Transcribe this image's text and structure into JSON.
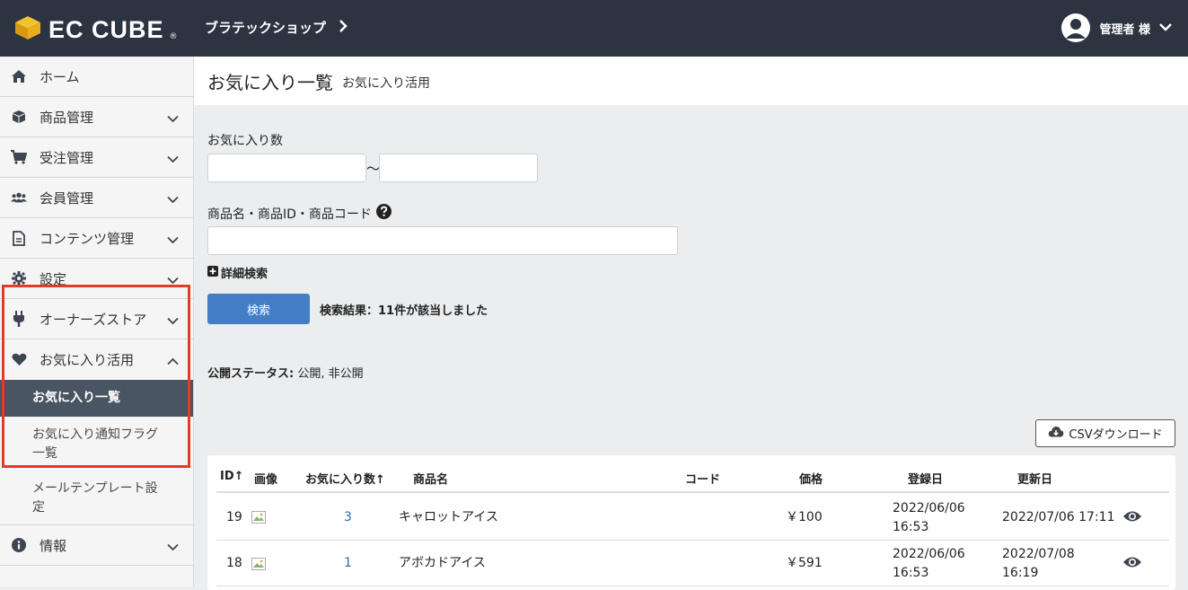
{
  "brand": {
    "logo_text": "EC CUBE",
    "logo_reg": "®"
  },
  "header": {
    "shop_name": "ブラテックショップ",
    "user_name": "管理者 様"
  },
  "sidebar": {
    "items": [
      {
        "label": "ホーム",
        "icon": "home-icon"
      },
      {
        "label": "商品管理",
        "icon": "box-icon"
      },
      {
        "label": "受注管理",
        "icon": "cart-icon"
      },
      {
        "label": "会員管理",
        "icon": "users-icon"
      },
      {
        "label": "コンテンツ管理",
        "icon": "file-icon"
      },
      {
        "label": "設定",
        "icon": "gear-icon"
      },
      {
        "label": "オーナーズストア",
        "icon": "plug-icon"
      },
      {
        "label": "お気に入り活用",
        "icon": "heart-icon"
      }
    ],
    "subitems": [
      "お気に入り一覧",
      "お気に入り通知フラグ一覧",
      "メールテンプレート設定"
    ],
    "info": {
      "label": "情報",
      "icon": "info-icon"
    }
  },
  "page": {
    "title": "お気に入り一覧",
    "subtitle": "お気に入り活用"
  },
  "search": {
    "fav_count_label": "お気に入り数",
    "range_sep": "〜",
    "product_label": "商品名・商品ID・商品コード",
    "detail_toggle": "詳細検索",
    "search_button": "検索",
    "result_text": "検索結果：11件が該当しました",
    "status_label": "公開ステータス:",
    "status_value": "公開, 非公開"
  },
  "csv_button": "CSVダウンロード",
  "table": {
    "headers": {
      "id": "ID↑",
      "image": "画像",
      "fav": "お気に入り数↑",
      "name": "商品名",
      "code": "コード",
      "price": "価格",
      "created": "登録日",
      "updated": "更新日"
    },
    "rows": [
      {
        "id": "19",
        "fav": "3",
        "name": "キャロットアイス",
        "code": "",
        "price": "￥100",
        "created_1": "2022/06/06",
        "created_2": "16:53",
        "updated_1": "2022/07/06 17:11",
        "updated_2": ""
      },
      {
        "id": "18",
        "fav": "1",
        "name": "アボカドアイス",
        "code": "",
        "price": "￥591",
        "created_1": "2022/06/06",
        "created_2": "16:53",
        "updated_1": "2022/07/08",
        "updated_2": "16:19"
      }
    ]
  },
  "colors": {
    "topbar": "#2c3441",
    "accent": "#437ec4",
    "highlight": "#e53b24",
    "active_sub": "#4a5563",
    "link": "#2e6aa8"
  }
}
